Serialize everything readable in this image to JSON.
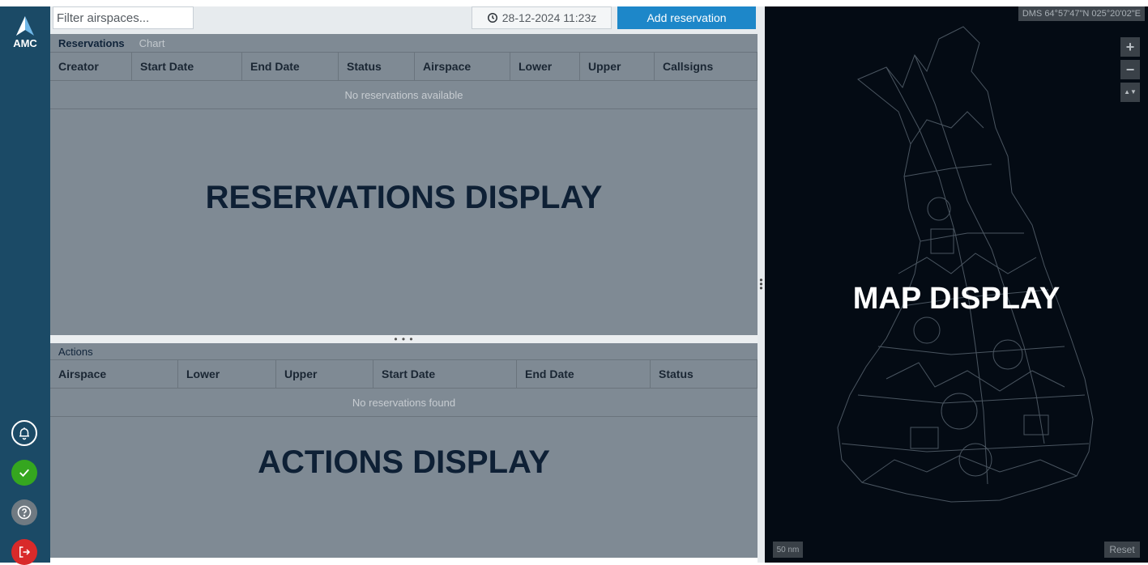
{
  "app": {
    "logo_text": "AMC"
  },
  "toolbar": {
    "filter_placeholder": "Filter airspaces...",
    "datetime": "28-12-2024 11:23z",
    "add_reservation_label": "Add reservation"
  },
  "reservations": {
    "tabs": [
      {
        "label": "Reservations",
        "active": true
      },
      {
        "label": "Chart",
        "active": false
      }
    ],
    "columns": [
      "Creator",
      "Start Date",
      "End Date",
      "Status",
      "Airspace",
      "Lower",
      "Upper",
      "Callsigns"
    ],
    "empty_message": "No reservations available",
    "display_label": "RESERVATIONS DISPLAY"
  },
  "actions": {
    "title": "Actions",
    "columns": [
      "Airspace",
      "Lower",
      "Upper",
      "Start Date",
      "End Date",
      "Status"
    ],
    "empty_message": "No reservations found",
    "display_label": "ACTIONS DISPLAY"
  },
  "map": {
    "coordinates": "DMS 64°57'47\"N 025°20'02\"E",
    "zoom_in": "+",
    "zoom_out": "−",
    "compass": "▲▼",
    "display_label": "MAP DISPLAY",
    "scale": "50 nm",
    "reset_label": "Reset"
  },
  "sidebar_buttons": [
    {
      "icon": "bell-icon"
    },
    {
      "icon": "checkmark-icon"
    },
    {
      "icon": "help-icon"
    },
    {
      "icon": "logout-icon"
    }
  ],
  "colors": {
    "sidebar": "#1b4a66",
    "accent": "#1d87c9",
    "success": "#35a61f",
    "danger": "#d92a2a",
    "panel": "#7f8a94",
    "map": "#040b14"
  }
}
